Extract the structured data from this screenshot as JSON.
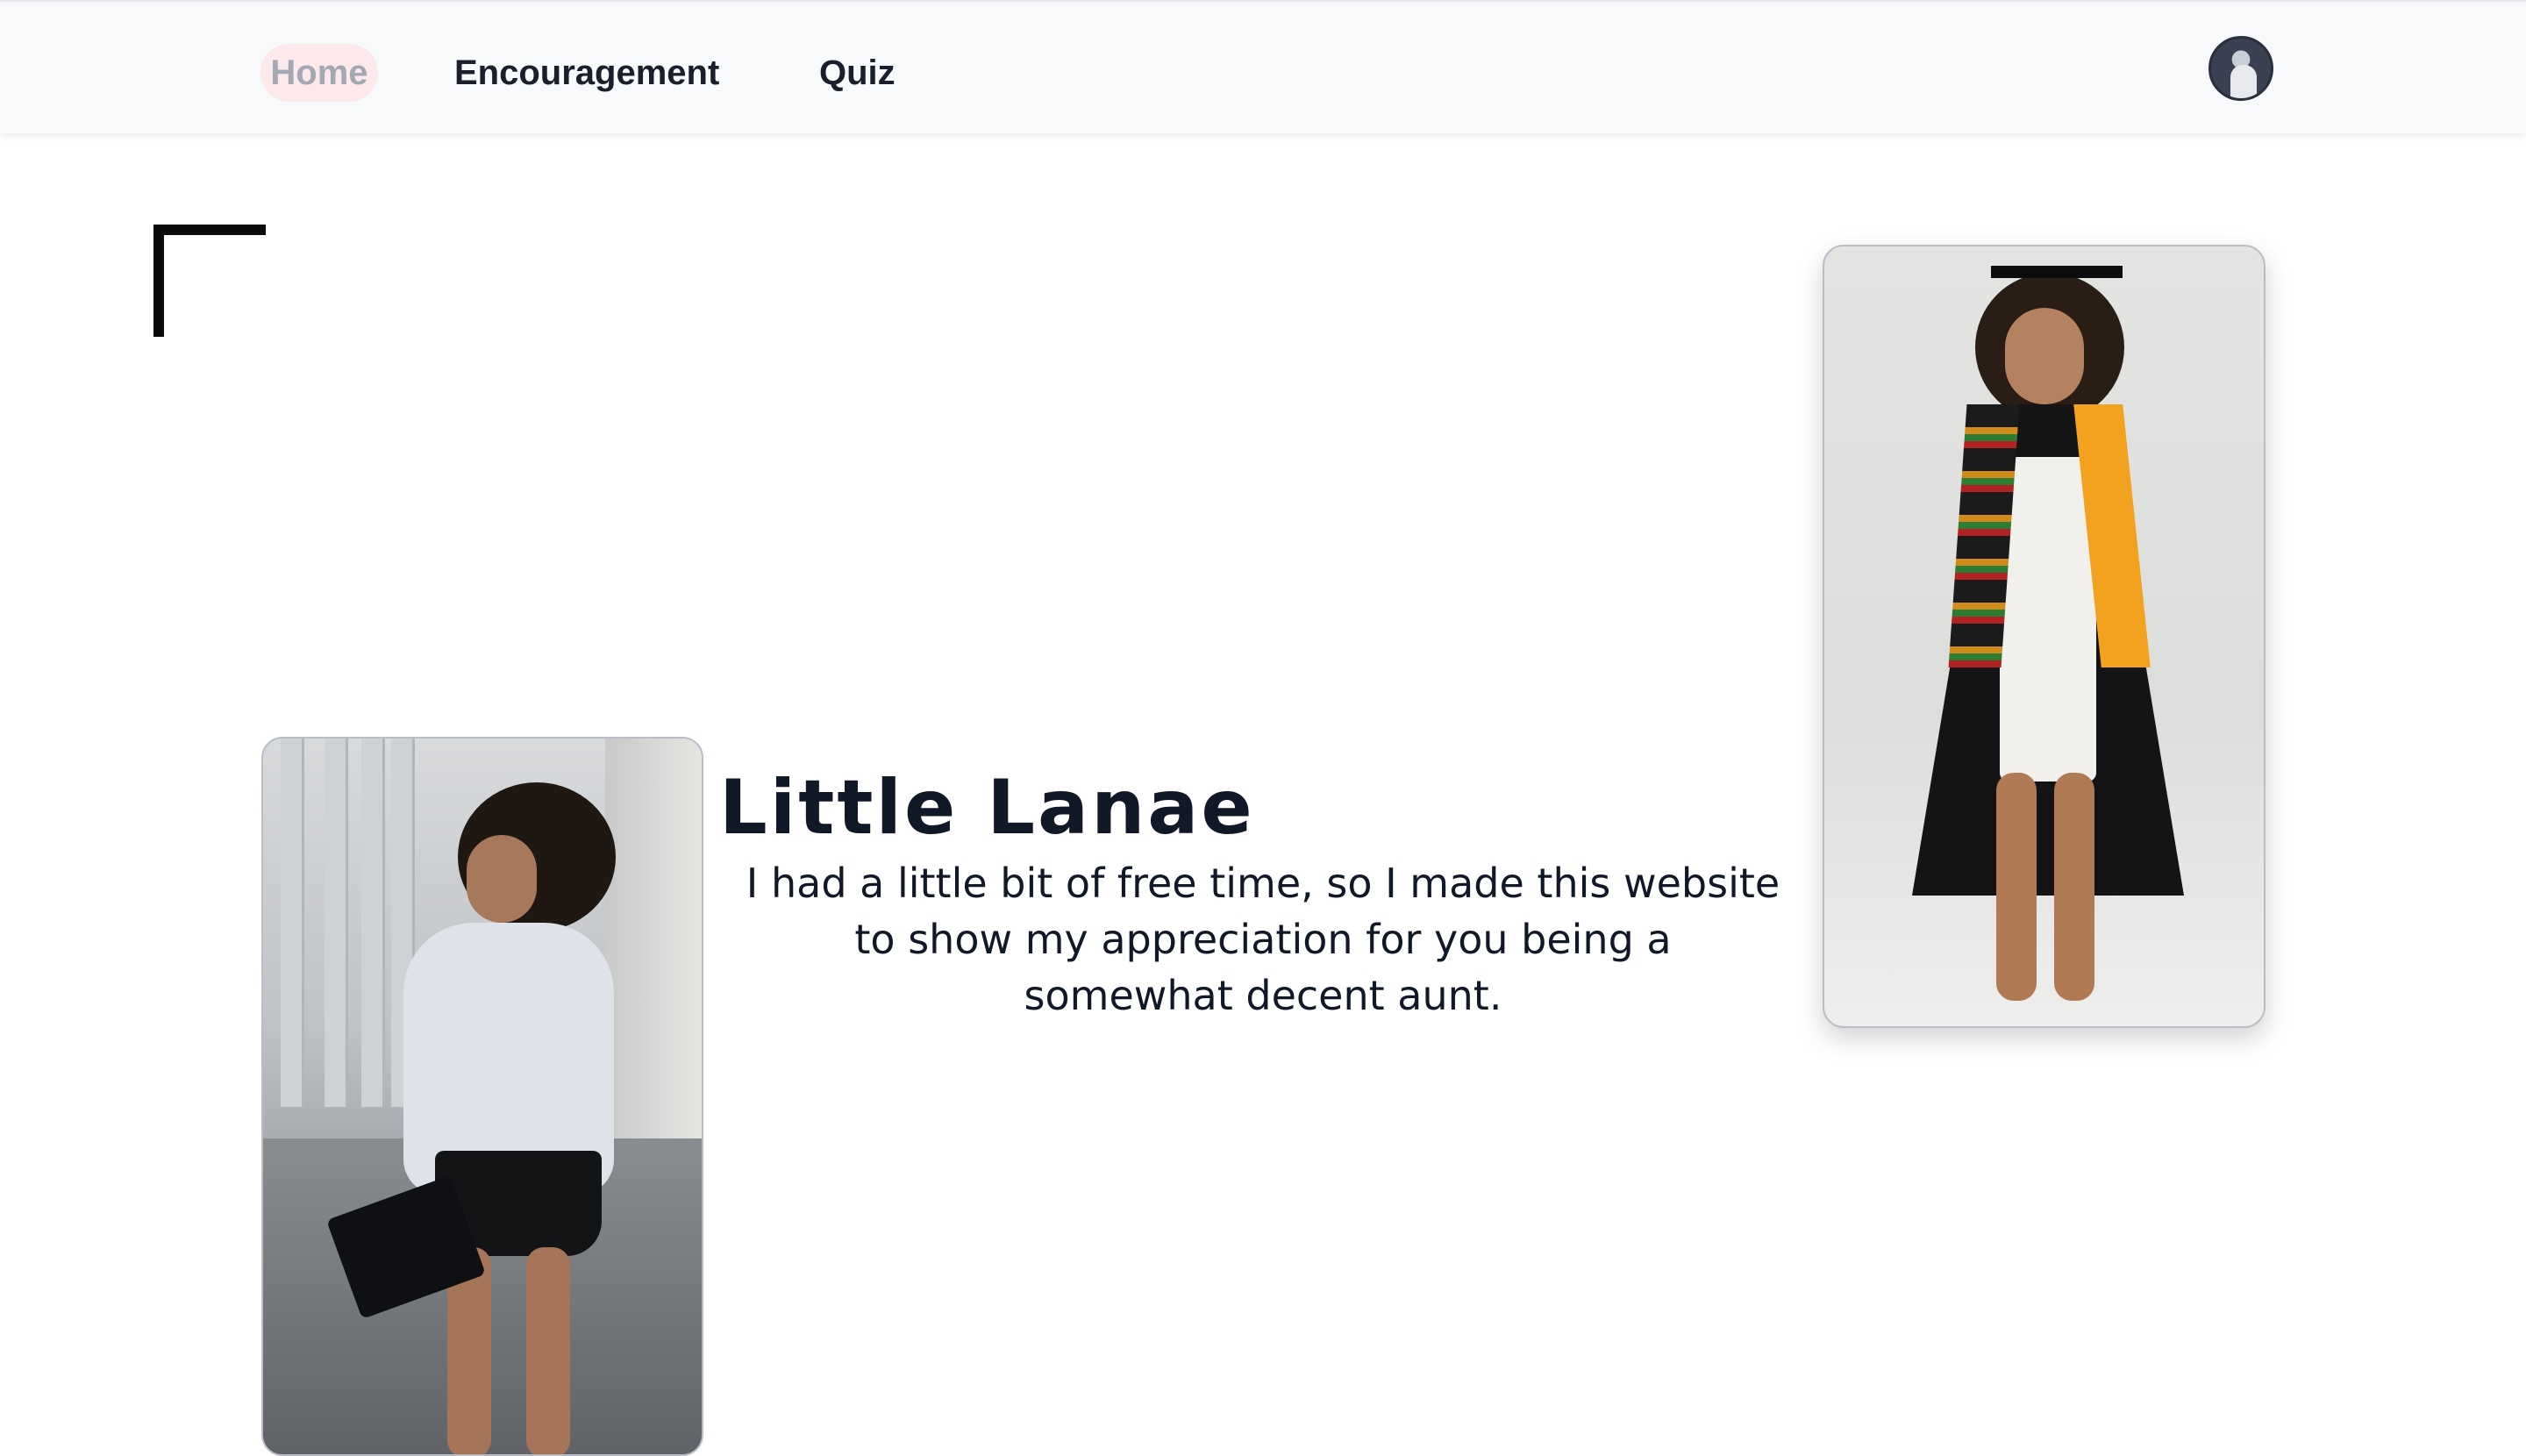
{
  "nav": {
    "items": [
      {
        "label": "Home",
        "active": true
      },
      {
        "label": "Encouragement",
        "active": false
      },
      {
        "label": "Quiz",
        "active": false
      }
    ],
    "avatar_icon": "user-avatar",
    "active_color": "#fde8ec"
  },
  "hero": {
    "title": "Little Lanae",
    "message": "I had a little bit of free time, so I made this website to show my appreciation for you being a somewhat decent aunt."
  },
  "colors": {
    "text": "#111827",
    "accent": "#fde8ec"
  }
}
